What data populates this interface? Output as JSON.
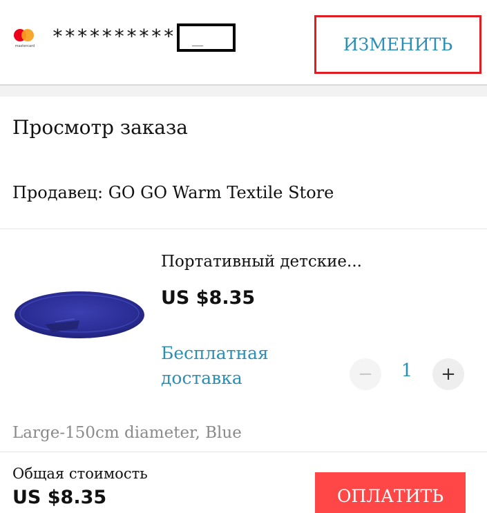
{
  "payment": {
    "card_brand_text": "mastercard",
    "card_number": "***********",
    "change_label": "ИЗМЕНИТЬ"
  },
  "order": {
    "title": "Просмотр заказа",
    "seller": "Продавец: GO GO Warm Textile Store"
  },
  "product": {
    "name": "Портативный детские...",
    "price": "US $8.35",
    "shipping": "Бесплатная доставка",
    "quantity": "1",
    "minus_label": "−",
    "plus_label": "+",
    "variant": "Large-150cm diameter, Blue",
    "image_icon": "blue-round-mat-image"
  },
  "summary": {
    "total_label": "Общая стоимость",
    "total_value": "US $8.35",
    "pay_label": "ОПЛАТИТЬ"
  },
  "colors": {
    "accent_blue": "#2a8fb3",
    "pay_red": "#ff4747",
    "highlight_border": "#e01b22",
    "variant_gray": "#8a8a8a"
  }
}
